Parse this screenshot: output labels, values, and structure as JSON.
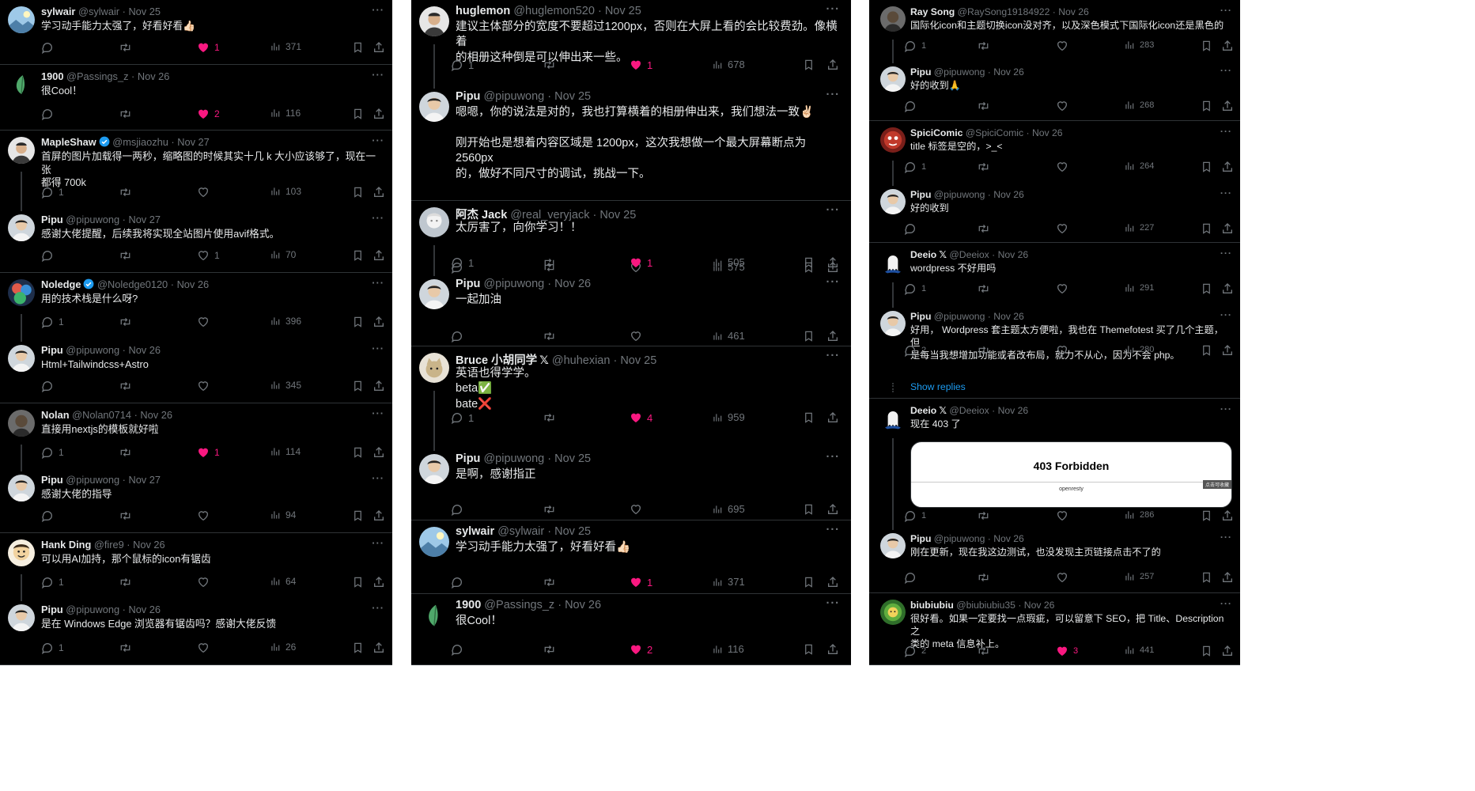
{
  "columns": [
    [
      {
        "name": "sylwair",
        "handle": "@sylwair",
        "date": "Nov 25",
        "text": [
          "学习动手能力太强了，好看好看👍🏻"
        ],
        "replies": "",
        "retweets": "",
        "likes": "1",
        "liked": true,
        "views": "371",
        "avatar": "landscape"
      },
      {
        "name": "1900",
        "handle": "@Passings_z",
        "date": "Nov 26",
        "text": [
          "很Cool！"
        ],
        "replies": "",
        "retweets": "",
        "likes": "2",
        "liked": true,
        "views": "116",
        "avatar": "leaf"
      },
      {
        "name": "MapleShaw",
        "handle": "@msjiaozhu",
        "date": "Nov 27",
        "verified": true,
        "text": [
          "首屏的图片加载得一两秒，缩略图的时候其实十几 k 大小应该够了，现在一张",
          "都得 700k"
        ],
        "replies": "1",
        "retweets": "",
        "likes": "",
        "liked": false,
        "views": "103",
        "avatar": "man",
        "thread": true
      },
      {
        "name": "Pipu",
        "handle": "@pipuwong",
        "date": "Nov 27",
        "text": [
          "感谢大佬提醒，后续我将实现全站图片使用avif格式。"
        ],
        "replies": "",
        "retweets": "",
        "likes": "1",
        "liked": false,
        "views": "70",
        "avatar": "pipu"
      },
      {
        "name": "Noledge",
        "handle": "@Noledge0120",
        "date": "Nov 26",
        "verified": true,
        "text": [
          "用的技术栈是什么呀?"
        ],
        "replies": "1",
        "retweets": "",
        "likes": "",
        "liked": false,
        "views": "396",
        "avatar": "colorful",
        "thread": true
      },
      {
        "name": "Pipu",
        "handle": "@pipuwong",
        "date": "Nov 26",
        "text": [
          "Html+Tailwindcss+Astro"
        ],
        "replies": "",
        "retweets": "",
        "likes": "",
        "liked": false,
        "views": "345",
        "avatar": "pipu"
      },
      {
        "name": "Nolan",
        "handle": "@Nolan0714",
        "date": "Nov 26",
        "text": [
          "直接用nextjs的模板就好啦"
        ],
        "replies": "1",
        "retweets": "",
        "likes": "1",
        "liked": true,
        "views": "114",
        "avatar": "dark",
        "thread": true
      },
      {
        "name": "Pipu",
        "handle": "@pipuwong",
        "date": "Nov 27",
        "text": [
          "感谢大佬的指导"
        ],
        "replies": "",
        "retweets": "",
        "likes": "",
        "liked": false,
        "views": "94",
        "avatar": "pipu"
      },
      {
        "name": "Hank Ding",
        "handle": "@fire9",
        "date": "Nov 26",
        "text": [
          "可以用AI加持，那个鼠标的icon有锯齿"
        ],
        "replies": "1",
        "retweets": "",
        "likes": "",
        "liked": false,
        "views": "64",
        "avatar": "cartoon",
        "thread": true
      },
      {
        "name": "Pipu",
        "handle": "@pipuwong",
        "date": "Nov 26",
        "text": [
          "是在 Windows Edge 浏览器有锯齿吗？感谢大佬反馈"
        ],
        "replies": "1",
        "retweets": "",
        "likes": "",
        "liked": false,
        "views": "26",
        "avatar": "pipu"
      }
    ],
    [
      {
        "name": "huglemon",
        "handle": "@huglemon520",
        "date": "Nov 25",
        "text": [
          "建议主体部分的宽度不要超过1200px，否则在大屏上看的会比较费劲。像横着",
          "的相册这种倒是可以伸出来一些。"
        ],
        "replies": "1",
        "retweets": "",
        "likes": "1",
        "liked": true,
        "views": "678",
        "avatar": "man",
        "thread": true
      },
      {
        "name": "Pipu",
        "handle": "@pipuwong",
        "date": "Nov 25",
        "text": [
          "嗯嗯，你的说法是对的，我也打算横着的相册伸出来，我们想法一致✌🏻",
          "",
          "刚开始也是想着内容区域是 1200px，这次我想做一个最大屏幕断点为 2560px",
          "的，做好不同尺寸的调试，挑战一下。"
        ],
        "replies": "",
        "retweets": "",
        "likes": "",
        "liked": false,
        "views": "575",
        "avatar": "pipu"
      },
      {
        "name": "阿杰 Jack",
        "handle": "@real_veryjack",
        "date": "Nov 25",
        "text": [
          "太厉害了，向你学习！！"
        ],
        "replies": "1",
        "retweets": "",
        "likes": "1",
        "liked": true,
        "views": "505",
        "avatar": "white",
        "thread": true
      },
      {
        "name": "Pipu",
        "handle": "@pipuwong",
        "date": "Nov 26",
        "text": [
          "一起加油"
        ],
        "replies": "",
        "retweets": "",
        "likes": "",
        "liked": false,
        "views": "461",
        "avatar": "pipu"
      },
      {
        "name": "Bruce 小胡同学",
        "handle": "@huhexian",
        "date": "Nov 25",
        "xbadge": true,
        "text": [
          "英语也得学学。",
          "beta✅",
          "bate❌"
        ],
        "replies": "1",
        "retweets": "",
        "likes": "4",
        "liked": true,
        "views": "959",
        "avatar": "cat",
        "thread": true
      },
      {
        "name": "Pipu",
        "handle": "@pipuwong",
        "date": "Nov 25",
        "text": [
          "是啊，感谢指正"
        ],
        "replies": "",
        "retweets": "",
        "likes": "",
        "liked": false,
        "views": "695",
        "avatar": "pipu"
      },
      {
        "name": "sylwair",
        "handle": "@sylwair",
        "date": "Nov 25",
        "text": [
          "学习动手能力太强了，好看好看👍🏻"
        ],
        "replies": "",
        "retweets": "",
        "likes": "1",
        "liked": true,
        "views": "371",
        "avatar": "landscape"
      },
      {
        "name": "1900",
        "handle": "@Passings_z",
        "date": "Nov 26",
        "text": [
          "很Cool！"
        ],
        "replies": "",
        "retweets": "",
        "likes": "2",
        "liked": true,
        "views": "116",
        "avatar": "leaf"
      }
    ],
    [
      {
        "name": "Ray Song",
        "handle": "@RaySong19184922",
        "date": "Nov 26",
        "text": [
          "国际化icon和主题切换icon没对齐，以及深色模式下国际化icon还是黑色的"
        ],
        "replies": "1",
        "retweets": "",
        "likes": "",
        "liked": false,
        "views": "283",
        "avatar": "dark",
        "thread": true
      },
      {
        "name": "Pipu",
        "handle": "@pipuwong",
        "date": "Nov 26",
        "text": [
          "好的收到🙏"
        ],
        "replies": "",
        "retweets": "",
        "likes": "",
        "liked": false,
        "views": "268",
        "avatar": "pipu"
      },
      {
        "name": "SpiciComic",
        "handle": "@SpiciComic",
        "date": "Nov 26",
        "text": [
          "title 标签是空的，>_<"
        ],
        "replies": "1",
        "retweets": "",
        "likes": "",
        "liked": false,
        "views": "264",
        "avatar": "red",
        "thread": true
      },
      {
        "name": "Pipu",
        "handle": "@pipuwong",
        "date": "Nov 26",
        "text": [
          "好的收到"
        ],
        "replies": "",
        "retweets": "",
        "likes": "",
        "liked": false,
        "views": "227",
        "avatar": "pipu"
      },
      {
        "name": "Deeio",
        "handle": "@Deeiox",
        "date": "Nov 26",
        "xbadge": true,
        "text": [
          "wordpress 不好用吗"
        ],
        "replies": "1",
        "retweets": "",
        "likes": "",
        "liked": false,
        "views": "291",
        "avatar": "ghost",
        "thread": true
      },
      {
        "name": "Pipu",
        "handle": "@pipuwong",
        "date": "Nov 26",
        "text": [
          "好用， Wordpress 套主题太方便啦，我也在 Themefotest 买了几个主题，但",
          "是每当我想增加功能或者改布局，就力不从心，因为不会 php。"
        ],
        "replies": "2",
        "retweets": "",
        "likes": "",
        "liked": false,
        "views": "280",
        "avatar": "pipu",
        "showReplies": "Show replies"
      },
      {
        "name": "Deeio",
        "handle": "@Deeiox",
        "date": "Nov 26",
        "xbadge": true,
        "text": [
          "现在 403 了"
        ],
        "replies": "1",
        "retweets": "",
        "likes": "",
        "liked": false,
        "views": "286",
        "avatar": "ghost",
        "thread": true,
        "card": {
          "title": "403 Forbidden",
          "sub": "openresty",
          "tag": "点击可收藏"
        }
      },
      {
        "name": "Pipu",
        "handle": "@pipuwong",
        "date": "Nov 26",
        "text": [
          "刚在更新，现在我这边测试，也没发现主页链接点击不了的"
        ],
        "replies": "",
        "retweets": "",
        "likes": "",
        "liked": false,
        "views": "257",
        "avatar": "pipu"
      },
      {
        "name": "biubiubiu",
        "handle": "@biubiubiu35",
        "date": "Nov 26",
        "text": [
          "很好看。如果一定要找一点瑕疵，可以留意下 SEO，把 Title、Description 之",
          "类的 meta 信息补上。"
        ],
        "replies": "2",
        "retweets": "",
        "likes": "3",
        "liked": true,
        "views": "441",
        "avatar": "green"
      }
    ]
  ],
  "more_glyph": "···",
  "colors": {
    "background": "#000000",
    "text": "#e7e9ea",
    "muted": "#71767b",
    "like": "#f91880",
    "link": "#1d9bf0",
    "verified": "#1d9bf0",
    "divider": "#2f3336"
  }
}
